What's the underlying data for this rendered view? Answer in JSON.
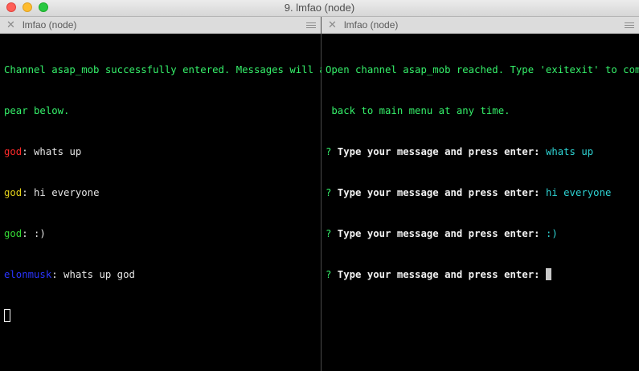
{
  "window": {
    "title": "9. lmfao (node)"
  },
  "left_pane": {
    "tab_title": "lmfao (node)",
    "close_glyph": "✕",
    "lines": [
      "Channel asap_mob successfully entered. Messages will ap",
      "pear below."
    ],
    "messages": [
      {
        "user": "god",
        "sep": ": ",
        "text": "whats up",
        "user_color": "#ff2a2a"
      },
      {
        "user": "god",
        "sep": ": ",
        "text": "hi everyone",
        "user_color": "#e3d11a"
      },
      {
        "user": "god",
        "sep": ": ",
        "text": ":)",
        "user_color": "#35d935"
      },
      {
        "user": "elonmusk",
        "sep": ": ",
        "text": "whats up god",
        "user_color": "#2a35ff"
      }
    ]
  },
  "right_pane": {
    "tab_title": "lmfao (node)",
    "close_glyph": "✕",
    "lines": [
      "Open channel asap_mob reached. Type 'exitexit' to come",
      " back to main menu at any time."
    ],
    "prompts": [
      {
        "mark": "?",
        "label": " Type your message and press enter: ",
        "answer": "whats up"
      },
      {
        "mark": "?",
        "label": " Type your message and press enter: ",
        "answer": "hi everyone"
      },
      {
        "mark": "?",
        "label": " Type your message and press enter: ",
        "answer": ":)"
      },
      {
        "mark": "?",
        "label": " Type your message and press enter: ",
        "answer": ""
      }
    ]
  },
  "colors": {
    "system_text": "#35f06a",
    "answer": "#2ed3d3",
    "prompt_mark": "#35f06a"
  }
}
